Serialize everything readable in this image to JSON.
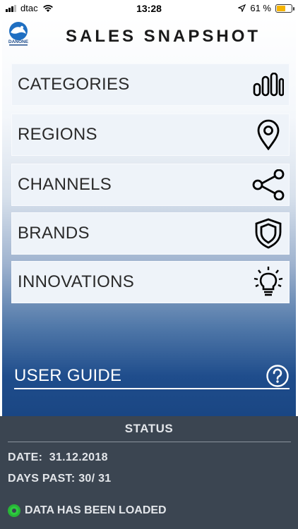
{
  "statusbar": {
    "carrier": "dtac",
    "time": "13:28",
    "battery_percent": "61 %",
    "battery_level": 0.61
  },
  "header": {
    "title": "SALES SNAPSHOT",
    "logo_text": "DANONE"
  },
  "menu": [
    {
      "label": "CATEGORIES",
      "icon": "bar-chart-icon"
    },
    {
      "label": "REGIONS",
      "icon": "location-pin-icon"
    },
    {
      "label": "CHANNELS",
      "icon": "share-icon"
    },
    {
      "label": "BRANDS",
      "icon": "shield-icon"
    },
    {
      "label": "INNOVATIONS",
      "icon": "lightbulb-icon"
    }
  ],
  "user_guide": {
    "label": "USER GUIDE",
    "icon": "question-icon"
  },
  "status": {
    "title": "STATUS",
    "date_label": "DATE:",
    "date_value": "31.12.2018",
    "days_label": "DAYS PAST:",
    "days_value": "30/ 31",
    "loaded_text": "DATA HAS BEEN LOADED"
  },
  "colors": {
    "accent": "#1f4d8c",
    "panel": "#3b4551",
    "status_ok": "#2ecc40"
  }
}
